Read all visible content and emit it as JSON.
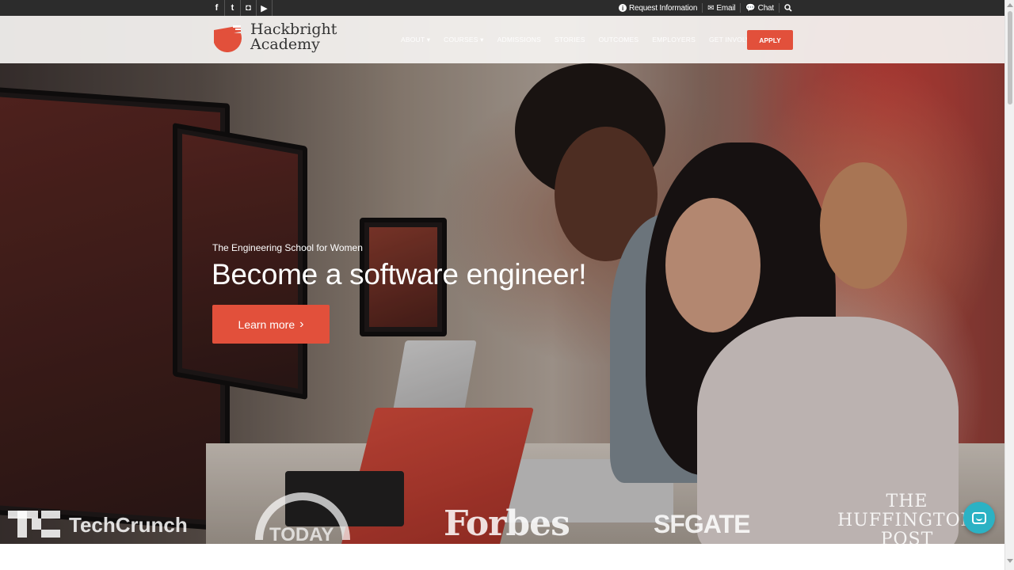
{
  "topbar": {
    "social": [
      {
        "icon": "facebook-icon",
        "glyph": "f"
      },
      {
        "icon": "twitter-icon",
        "glyph": "t"
      },
      {
        "icon": "instagram-icon",
        "glyph": "◘"
      },
      {
        "icon": "youtube-icon",
        "glyph": "▶"
      }
    ],
    "request_info": "Request Information",
    "email": "Email",
    "chat": "Chat"
  },
  "header": {
    "logo_line1": "Hackbright",
    "logo_line2": "Academy",
    "nav": [
      "ABOUT ▾",
      "COURSES ▾",
      "ADMISSIONS",
      "STORIES",
      "OUTCOMES",
      "EMPLOYERS",
      "GET INVOLVED ▾"
    ],
    "apply": "APPLY"
  },
  "hero": {
    "eyebrow": "The Engineering School for Women",
    "headline": "Become a software engineer!",
    "cta": "Learn more",
    "cta_chevron": "›"
  },
  "press": {
    "techcrunch": "TechCrunch",
    "today": "TODAY",
    "forbes": "Forbes",
    "sfgate": "SFGATE",
    "huffington_line1": "THE",
    "huffington_line2": "HUFFINGTON",
    "huffington_line3": "POST"
  },
  "colors": {
    "accent": "#e2503b",
    "topbar": "#2c2c2c",
    "chat_bubble": "#2bb2c4"
  }
}
